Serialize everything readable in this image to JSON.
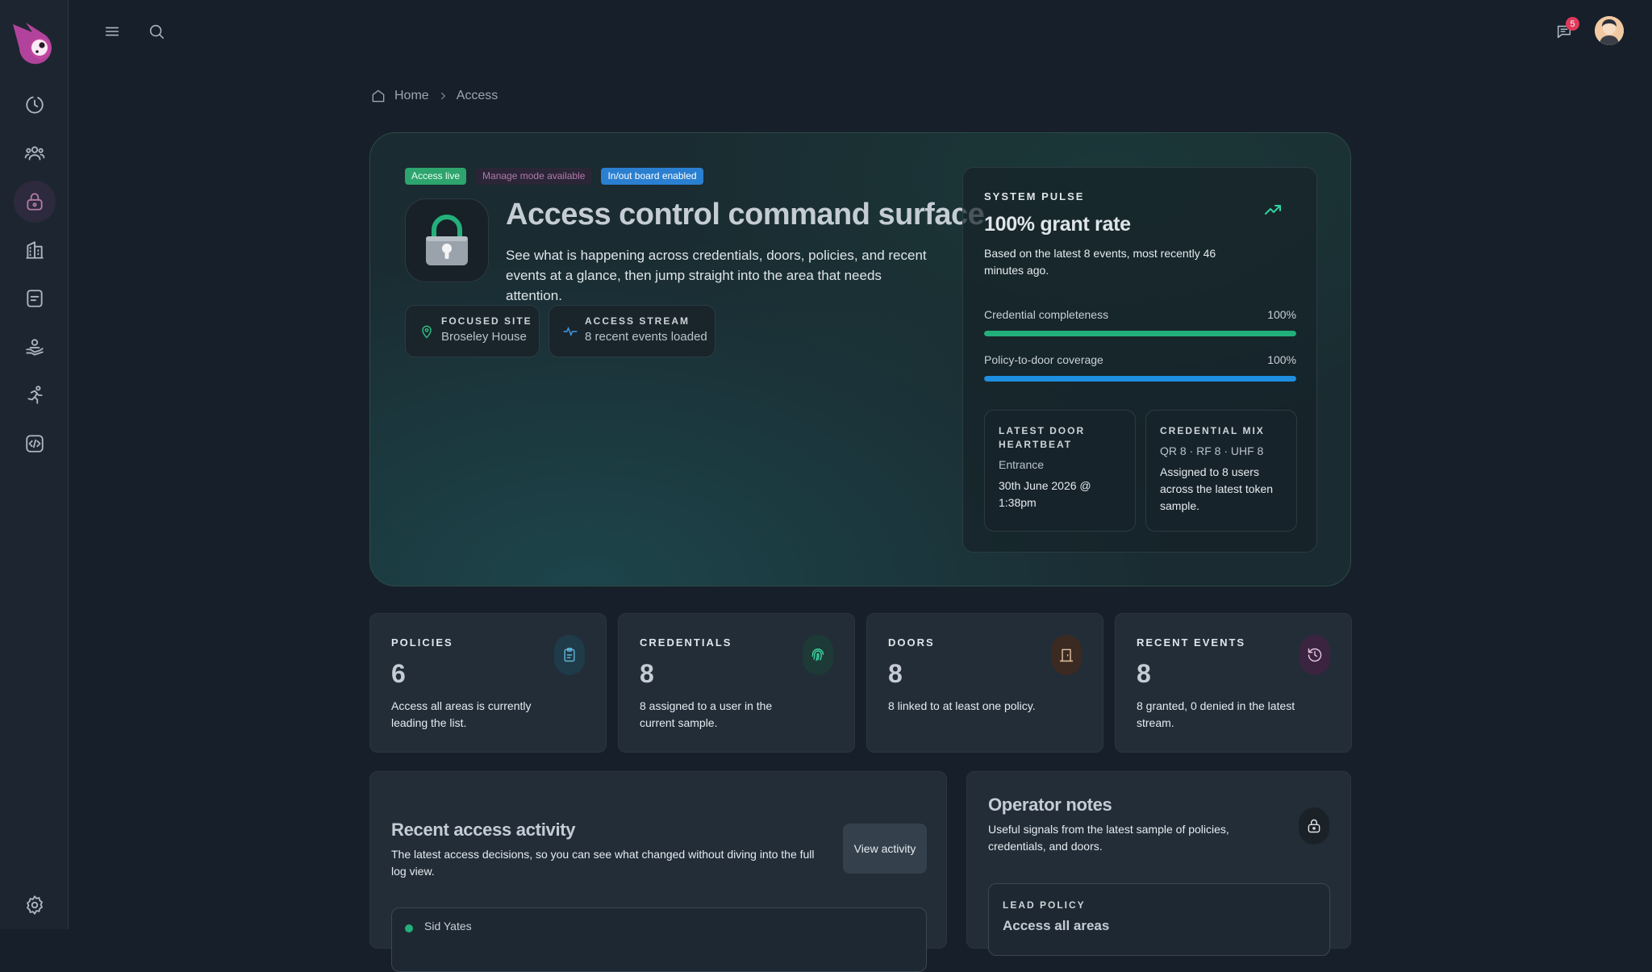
{
  "topbar": {
    "notification_count": "5"
  },
  "breadcrumb": {
    "home": "Home",
    "current": "Access"
  },
  "hero": {
    "tags": [
      "Access live",
      "Manage mode available",
      "In/out board enabled"
    ],
    "title": "Access control command surface",
    "subtitle": "See what is happening across credentials, doors, policies, and recent events at a glance, then jump straight into the area that needs attention.",
    "focused_site": {
      "label": "FOCUSED SITE",
      "value": "Broseley House"
    },
    "access_stream": {
      "label": "ACCESS STREAM",
      "value": "8 recent events loaded"
    }
  },
  "pulse": {
    "heading": "SYSTEM PULSE",
    "rate": "100% grant rate",
    "desc": "Based on the latest 8 events, most recently 46 minutes ago.",
    "bars": [
      {
        "label": "Credential completeness",
        "value": "100%",
        "fraction": 1.0,
        "color": "#22b07a"
      },
      {
        "label": "Policy-to-door coverage",
        "value": "100%",
        "fraction": 1.0,
        "color": "#1e8ee0"
      }
    ],
    "heartbeat": {
      "label": "LATEST DOOR HEARTBEAT",
      "door": "Entrance",
      "time": "30th June 2026 @ 1:38pm"
    },
    "mix": {
      "label": "CREDENTIAL MIX",
      "types": "QR 8 · RF 8 · UHF 8",
      "desc": "Assigned to 8 users across the latest token sample."
    }
  },
  "stats": [
    {
      "label": "POLICIES",
      "num": "6",
      "txt": "Access all areas is currently leading the list.",
      "icon": "clipboard-icon",
      "color": "#5fb6d8",
      "bg": "#1f3a48"
    },
    {
      "label": "CREDENTIALS",
      "num": "8",
      "txt": "8 assigned to a user in the current sample.",
      "icon": "fingerprint-icon",
      "color": "#3bd6a2",
      "bg": "#1d3a36"
    },
    {
      "label": "DOORS",
      "num": "8",
      "txt": "8 linked to at least one policy.",
      "icon": "door-icon",
      "color": "#e6c3a4",
      "bg": "#3b2a22"
    },
    {
      "label": "RECENT EVENTS",
      "num": "8",
      "txt": "8 granted, 0 denied in the latest stream.",
      "icon": "history-icon",
      "color": "#e9c8e4",
      "bg": "#3a2440"
    }
  ],
  "activity": {
    "title": "Recent access activity",
    "desc": "The latest access decisions, so you can see what changed without diving into the full log view.",
    "button": "View activity",
    "first_row": "Sid Yates"
  },
  "notes": {
    "title": "Operator notes",
    "desc": "Useful signals from the latest sample of policies, credentials, and doors.",
    "lead_label": "LEAD POLICY",
    "lead_value": "Access all areas"
  }
}
